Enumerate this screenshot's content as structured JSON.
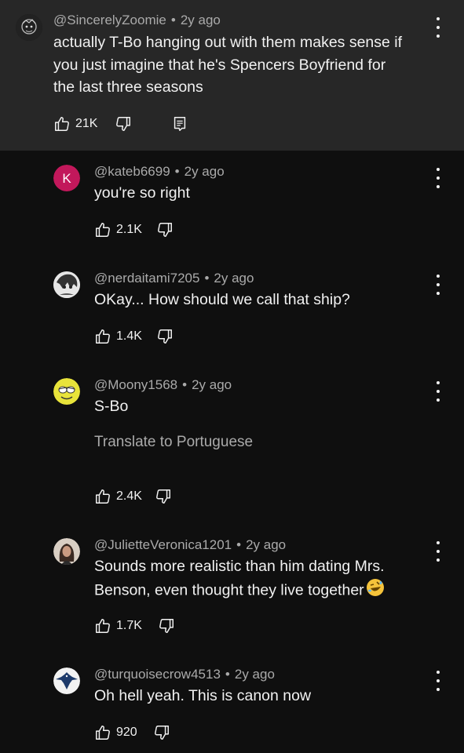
{
  "comments": [
    {
      "author": "@SincerelyZoomie",
      "time": "2y ago",
      "text_lines": [
        "actually T-Bo hanging out with them makes sense if",
        "you just imagine that he's Spencers Boyfriend for",
        "the last three seasons"
      ],
      "likes": "21K",
      "avatar_icon": "dark-sketch-avatar"
    },
    {
      "author": "@kateb6699",
      "time": "2y ago",
      "text_lines": [
        "you're so right"
      ],
      "likes": "2.1K",
      "avatar_letter": "K",
      "avatar_color": "#c2185b"
    },
    {
      "author": "@nerdaitami7205",
      "time": "2y ago",
      "text_lines": [
        "OKay... How should we call that ship?"
      ],
      "likes": "1.4K",
      "avatar_icon": "anime-character-avatar"
    },
    {
      "author": "@Moony1568",
      "time": "2y ago",
      "text_lines": [
        "S-Bo"
      ],
      "translate": "Translate to Portuguese",
      "likes": "2.4K",
      "avatar_icon": "yellow-cartoon-avatar"
    },
    {
      "author": "@JulietteVeronica1201",
      "time": "2y ago",
      "text_lines": [
        "Sounds more realistic than him dating Mrs.",
        "Benson, even thought they live together"
      ],
      "likes": "1.7K",
      "avatar_icon": "woman-portrait-avatar",
      "emoji": "rolling-on-floor-laughing-emoji"
    },
    {
      "author": "@turquoisecrow4513",
      "time": "2y ago",
      "text_lines": [
        "Oh hell yeah. This is canon now"
      ],
      "likes": "920",
      "avatar_icon": "crow-avatar"
    }
  ],
  "separator": "•",
  "colors": {
    "background": "#0f0f0f",
    "highlighted_background": "#272727",
    "primary_text": "#f1f1f1",
    "secondary_text": "#aaaaaa"
  }
}
